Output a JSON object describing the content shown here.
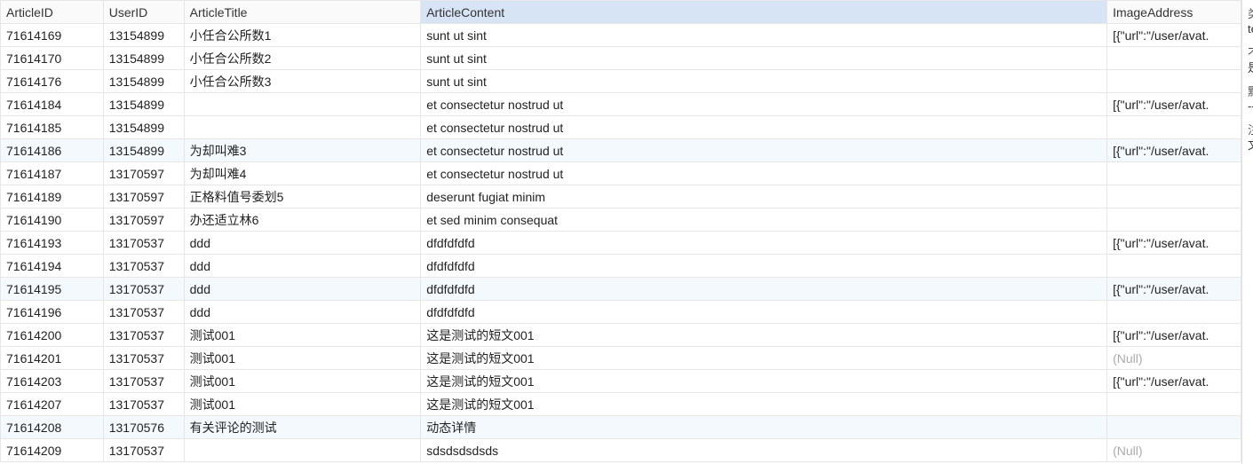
{
  "columns": [
    {
      "key": "ArticleID",
      "label": "ArticleID",
      "numeric": true
    },
    {
      "key": "UserID",
      "label": "UserID",
      "numeric": true
    },
    {
      "key": "ArticleTitle",
      "label": "ArticleTitle",
      "numeric": false
    },
    {
      "key": "ArticleContent",
      "label": "ArticleContent",
      "numeric": false,
      "selected": true
    },
    {
      "key": "ImageAddress",
      "label": "ImageAddress",
      "numeric": false
    }
  ],
  "rows": [
    {
      "ArticleID": "71614169",
      "UserID": "13154899",
      "ArticleTitle": "小任合公所数1",
      "ArticleContent": "sunt ut sint",
      "ImageAddress": "[{\"url\":\"/user/avat."
    },
    {
      "ArticleID": "71614170",
      "UserID": "13154899",
      "ArticleTitle": "小任合公所数2",
      "ArticleContent": "sunt ut sint",
      "ImageAddress": ""
    },
    {
      "ArticleID": "71614176",
      "UserID": "13154899",
      "ArticleTitle": "小任合公所数3",
      "ArticleContent": "sunt ut sint",
      "ImageAddress": ""
    },
    {
      "ArticleID": "71614184",
      "UserID": "13154899",
      "ArticleTitle": "",
      "ArticleContent": "et consectetur nostrud ut",
      "ImageAddress": "[{\"url\":\"/user/avat."
    },
    {
      "ArticleID": "71614185",
      "UserID": "13154899",
      "ArticleTitle": "",
      "ArticleContent": "et consectetur nostrud ut",
      "ImageAddress": ""
    },
    {
      "ArticleID": "71614186",
      "UserID": "13154899",
      "ArticleTitle": "为却叫难3",
      "ArticleContent": "et consectetur nostrud ut",
      "ImageAddress": "[{\"url\":\"/user/avat."
    },
    {
      "ArticleID": "71614187",
      "UserID": "13170597",
      "ArticleTitle": "为却叫难4",
      "ArticleContent": "et consectetur nostrud ut",
      "ImageAddress": ""
    },
    {
      "ArticleID": "71614189",
      "UserID": "13170597",
      "ArticleTitle": "正格料值号委划5",
      "ArticleContent": "deserunt fugiat minim",
      "ImageAddress": ""
    },
    {
      "ArticleID": "71614190",
      "UserID": "13170597",
      "ArticleTitle": "办还适立林6",
      "ArticleContent": "et sed minim consequat",
      "ImageAddress": ""
    },
    {
      "ArticleID": "71614193",
      "UserID": "13170537",
      "ArticleTitle": "ddd",
      "ArticleContent": "dfdfdfdfd",
      "ImageAddress": "[{\"url\":\"/user/avat."
    },
    {
      "ArticleID": "71614194",
      "UserID": "13170537",
      "ArticleTitle": "ddd",
      "ArticleContent": "dfdfdfdfd",
      "ImageAddress": ""
    },
    {
      "ArticleID": "71614195",
      "UserID": "13170537",
      "ArticleTitle": "ddd",
      "ArticleContent": "dfdfdfdfd",
      "ImageAddress": "[{\"url\":\"/user/avat."
    },
    {
      "ArticleID": "71614196",
      "UserID": "13170537",
      "ArticleTitle": "ddd",
      "ArticleContent": "dfdfdfdfd",
      "ImageAddress": ""
    },
    {
      "ArticleID": "71614200",
      "UserID": "13170537",
      "ArticleTitle": "测试001",
      "ArticleContent": "这是测试的短文001",
      "ImageAddress": "[{\"url\":\"/user/avat."
    },
    {
      "ArticleID": "71614201",
      "UserID": "13170537",
      "ArticleTitle": "测试001",
      "ArticleContent": "这是测试的短文001",
      "ImageAddress": "(Null)",
      "ImageNull": true
    },
    {
      "ArticleID": "71614203",
      "UserID": "13170537",
      "ArticleTitle": "测试001",
      "ArticleContent": "这是测试的短文001",
      "ImageAddress": "[{\"url\":\"/user/avat."
    },
    {
      "ArticleID": "71614207",
      "UserID": "13170537",
      "ArticleTitle": "测试001",
      "ArticleContent": "这是测试的短文001",
      "ImageAddress": ""
    },
    {
      "ArticleID": "71614208",
      "UserID": "13170576",
      "ArticleTitle": "有关评论的测试",
      "ArticleContent": "动态详情",
      "ImageAddress": ""
    },
    {
      "ArticleID": "71614209",
      "UserID": "13170537",
      "ArticleTitle": "",
      "ArticleContent": "sdsdsdsdsds",
      "ImageAddress": "(Null)",
      "ImageNull": true
    }
  ],
  "alt_rows": [
    5,
    11,
    17
  ],
  "info_panel": {
    "items": [
      {
        "label": "类",
        "value": "te"
      },
      {
        "label": "不",
        "value": "是"
      },
      {
        "label": "默",
        "value": "--"
      },
      {
        "label": "注",
        "value": "文"
      }
    ]
  }
}
